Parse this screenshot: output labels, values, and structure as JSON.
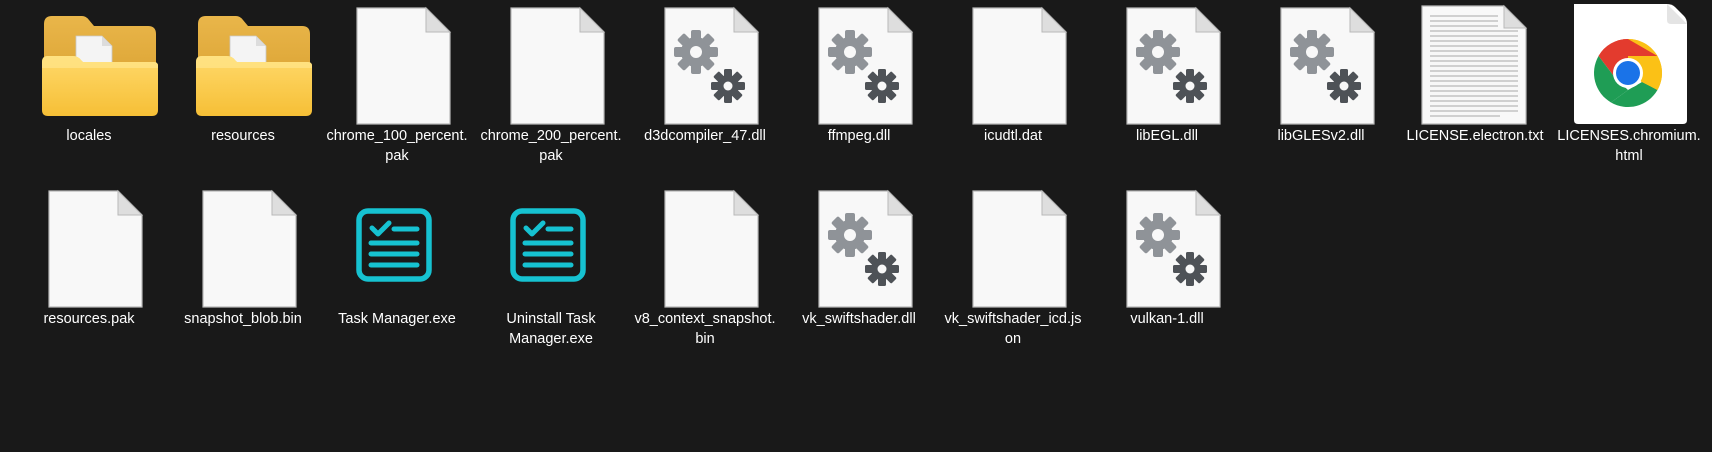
{
  "files": [
    {
      "name": "locales",
      "icon": "folder-icon"
    },
    {
      "name": "resources",
      "icon": "folder-icon"
    },
    {
      "name": "chrome_100_percent.pak",
      "icon": "blank-file-icon"
    },
    {
      "name": "chrome_200_percent.pak",
      "icon": "blank-file-icon"
    },
    {
      "name": "d3dcompiler_47.dll",
      "icon": "dll-gear-file-icon"
    },
    {
      "name": "ffmpeg.dll",
      "icon": "dll-gear-file-icon"
    },
    {
      "name": "icudtl.dat",
      "icon": "blank-file-icon"
    },
    {
      "name": "libEGL.dll",
      "icon": "dll-gear-file-icon"
    },
    {
      "name": "libGLESv2.dll",
      "icon": "dll-gear-file-icon"
    },
    {
      "name": "LICENSE.electron.txt",
      "icon": "text-file-icon"
    },
    {
      "name": "LICENSES.chromium.html",
      "icon": "chrome-html-file-icon"
    },
    {
      "name": "resources.pak",
      "icon": "blank-file-icon"
    },
    {
      "name": "snapshot_blob.bin",
      "icon": "blank-file-icon"
    },
    {
      "name": "Task Manager.exe",
      "icon": "task-manager-app-icon"
    },
    {
      "name": "Uninstall Task Manager.exe",
      "icon": "task-manager-app-icon"
    },
    {
      "name": "v8_context_snapshot.bin",
      "icon": "blank-file-icon"
    },
    {
      "name": "vk_swiftshader.dll",
      "icon": "dll-gear-file-icon"
    },
    {
      "name": "vk_swiftshader_icd.json",
      "icon": "blank-file-icon"
    },
    {
      "name": "vulkan-1.dll",
      "icon": "dll-gear-file-icon"
    }
  ]
}
